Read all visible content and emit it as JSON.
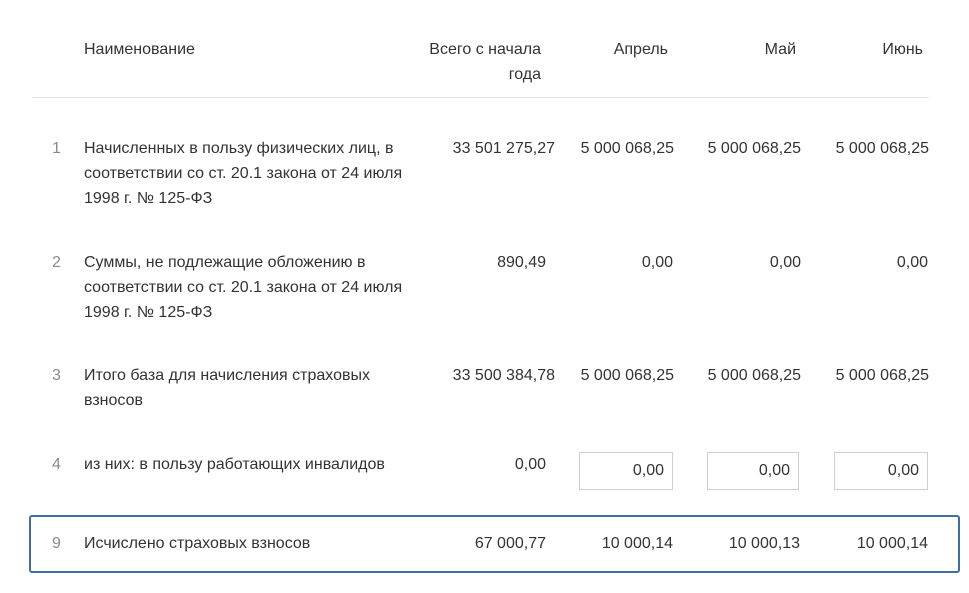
{
  "table": {
    "headers": {
      "name": "Наименование",
      "total_line1": "Всего с начала",
      "total_line2": "года",
      "april": "Апрель",
      "may": "Май",
      "june": "Июнь"
    },
    "rows": [
      {
        "number": "1",
        "name": "Начисленных в пользу физических лиц, в соответствии со ст. 20.1 закона от 24 июля 1998 г. № 125-ФЗ",
        "total": "33 501 275,27",
        "april": "5 000 068,25",
        "may": "5 000 068,25",
        "june": "5 000 068,25"
      },
      {
        "number": "2",
        "name": "Суммы, не подлежащие обложению в соответствии со ст. 20.1 закона от 24 июля 1998 г. № 125-ФЗ",
        "total": "890,49",
        "april": "0,00",
        "may": "0,00",
        "june": "0,00"
      },
      {
        "number": "3",
        "name": "Итого база для начисления страховых взносов",
        "total": "33 500 384,78",
        "april": "5 000 068,25",
        "may": "5 000 068,25",
        "june": "5 000 068,25"
      },
      {
        "number": "4",
        "name": "из них: в пользу работающих инвалидов",
        "total": "0,00",
        "april": "0,00",
        "may": "0,00",
        "june": "0,00"
      },
      {
        "number": "9",
        "name": "Исчислено страховых взносов",
        "total": "67 000,77",
        "april": "10 000,14",
        "may": "10 000,13",
        "june": "10 000,14"
      }
    ]
  },
  "colors": {
    "highlight_border": "#3d6fa5",
    "row_number": "#8a8a8a",
    "text": "#333333",
    "divider": "#e2e2e2"
  }
}
